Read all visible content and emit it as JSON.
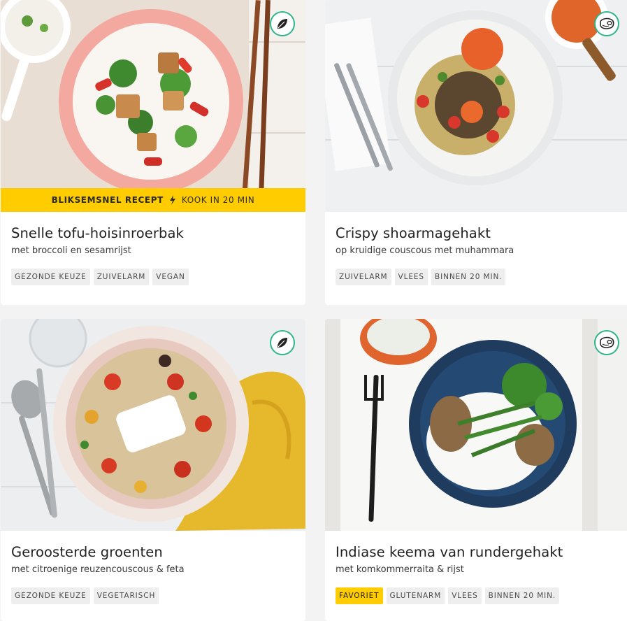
{
  "recipes": [
    {
      "title": "Snelle tofu-hoisinroerbak",
      "subtitle": "met broccoli en sesamrijst",
      "badge_icon": "leaf-icon",
      "banner": {
        "strong": "BLIKSEMSNEL RECEPT",
        "icon": "lightning-icon",
        "text": "KOOK IN 20 MIN"
      },
      "tags": [
        "GEZONDE KEUZE",
        "ZUIVELARM",
        "VEGAN"
      ]
    },
    {
      "title": "Crispy shoarmagehakt",
      "subtitle": "op kruidige couscous met muhammara",
      "badge_icon": "meat-icon",
      "tags": [
        "ZUIVELARM",
        "VLEES",
        "BINNEN 20 MIN."
      ]
    },
    {
      "title": "Geroosterde groenten",
      "subtitle": "met citroenige reuzencouscous & feta",
      "badge_icon": "leaf-icon",
      "tags": [
        "GEZONDE KEUZE",
        "VEGETARISCH"
      ]
    },
    {
      "title": "Indiase keema van rundergehakt",
      "subtitle": "met komkommerraita & rijst",
      "badge_icon": "meat-icon",
      "tags": [
        "FAVORIET",
        "GLUTENARM",
        "VLEES",
        "BINNEN 20 MIN."
      ]
    }
  ],
  "colors": {
    "accent": "#ffcc00",
    "badge_ring": "#2fb58a",
    "tag_bg": "#eeeeee"
  }
}
